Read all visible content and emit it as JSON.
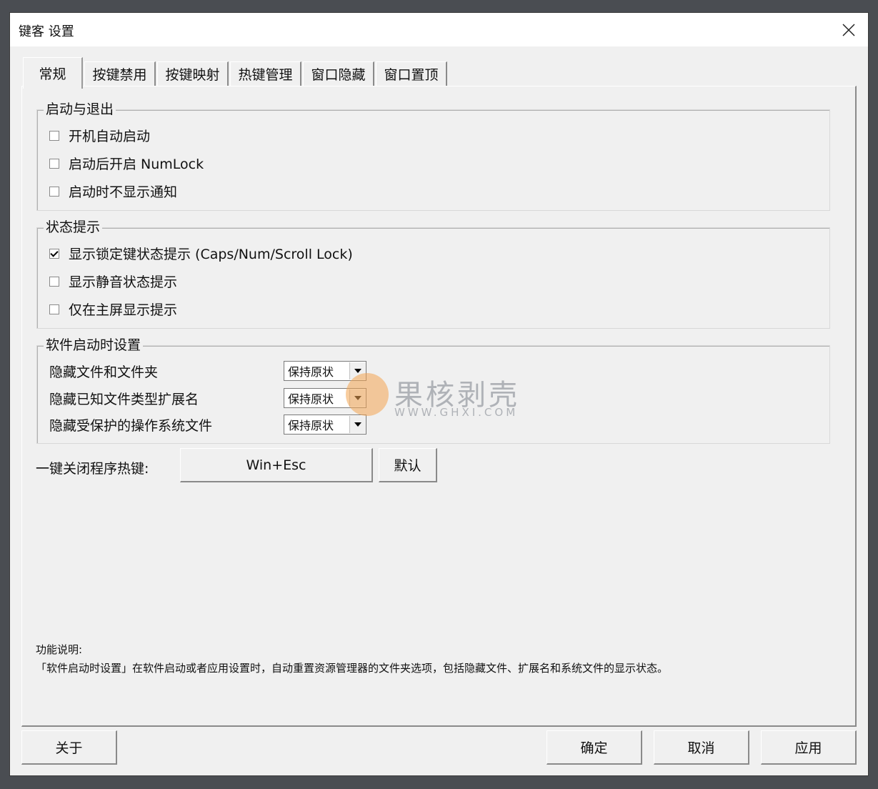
{
  "window": {
    "title": "键客 设置"
  },
  "tabs": [
    {
      "label": "常规",
      "active": true
    },
    {
      "label": "按键禁用",
      "active": false
    },
    {
      "label": "按键映射",
      "active": false
    },
    {
      "label": "热键管理",
      "active": false
    },
    {
      "label": "窗口隐藏",
      "active": false
    },
    {
      "label": "窗口置顶",
      "active": false
    }
  ],
  "startup_group": {
    "title": "启动与退出",
    "options": [
      {
        "label": "开机自动启动",
        "checked": false
      },
      {
        "label": "启动后开启 NumLock",
        "checked": false
      },
      {
        "label": "启动时不显示通知",
        "checked": false
      }
    ]
  },
  "status_group": {
    "title": "状态提示",
    "options": [
      {
        "label": "显示锁定键状态提示 (Caps/Num/Scroll Lock)",
        "checked": true
      },
      {
        "label": "显示静音状态提示",
        "checked": false
      },
      {
        "label": "仅在主屏显示提示",
        "checked": false
      }
    ]
  },
  "software_group": {
    "title": "软件启动时设置",
    "settings": [
      {
        "label": "隐藏文件和文件夹",
        "value": "保持原状"
      },
      {
        "label": "隐藏已知文件类型扩展名",
        "value": "保持原状"
      },
      {
        "label": "隐藏受保护的操作系统文件",
        "value": "保持原状"
      }
    ]
  },
  "hotkey": {
    "label": "一键关闭程序热键:",
    "value": "Win+Esc",
    "default_button": "默认"
  },
  "description": {
    "title": "功能说明:",
    "text": "「软件启动时设置」在软件启动或者应用设置时，自动重置资源管理器的文件夹选项，包括隐藏文件、扩展名和系统文件的显示状态。"
  },
  "watermark": {
    "text": "果核剥壳",
    "url": "WWW.GHXI.COM"
  },
  "buttons": {
    "about": "关于",
    "ok": "确定",
    "cancel": "取消",
    "apply": "应用"
  }
}
